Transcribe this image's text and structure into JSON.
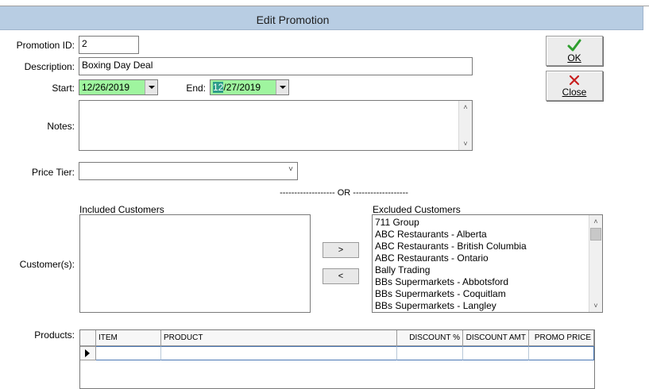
{
  "window": {
    "title": "Edit Promotion"
  },
  "form": {
    "promotion_id_label": "Promotion ID:",
    "promotion_id_value": "2",
    "description_label": "Description:",
    "description_value": "Boxing Day Deal",
    "start_label": "Start:",
    "start_value_rest": "12/26/2019",
    "end_label": "End:",
    "end_value_highlight": "12",
    "end_value_rest": "/27/2019",
    "notes_label": "Notes:",
    "notes_value": "",
    "price_tier_label": "Price Tier:",
    "price_tier_value": "",
    "or_divider": "------------------- OR -------------------",
    "customers_label": "Customer(s):",
    "included_label": "Included Customers",
    "excluded_label": "Excluded Customers",
    "products_label": "Products:"
  },
  "buttons": {
    "ok_label": "OK",
    "close_label": "Close",
    "move_right": ">",
    "move_left": "<"
  },
  "excluded_customers": [
    "711 Group",
    "ABC Restaurants - Alberta",
    "ABC Restaurants - British Columbia",
    "ABC Restaurants - Ontario",
    "Bally Trading",
    "BBs Supermarkets - Abbotsford",
    "BBs Supermarkets - Coquitlam",
    "BBs Supermarkets - Langley"
  ],
  "products_grid": {
    "columns": [
      "ITEM",
      "PRODUCT",
      "DISCOUNT %",
      "DISCOUNT AMT",
      "PROMO PRICE"
    ]
  },
  "colors": {
    "date_bg": "#9ff59f",
    "title_bar": "#b8cde3",
    "ok_check": "#2e9e2e",
    "close_x": "#c81e1e"
  },
  "icons": {
    "ok": "checkmark-icon",
    "close": "x-icon"
  }
}
